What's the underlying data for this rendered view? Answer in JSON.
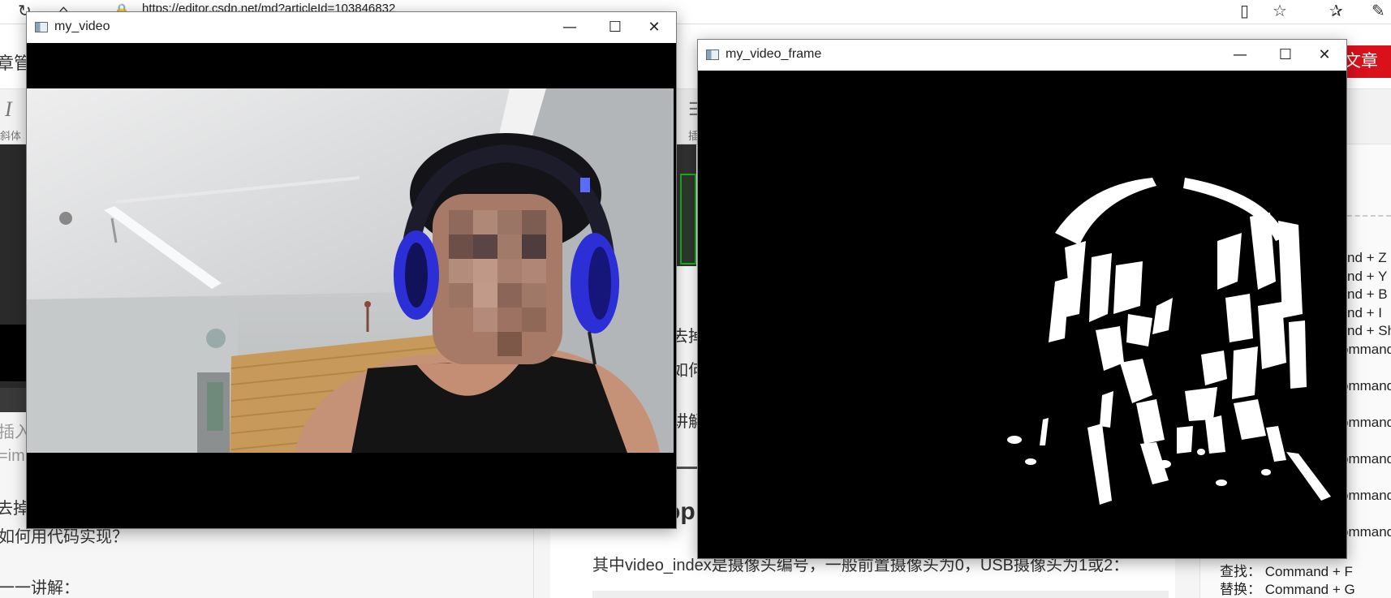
{
  "browser": {
    "url": "https://editor.csdn.net/md?articleId=103846832",
    "refresh_icon": "refresh-icon",
    "home_icon": "home-icon",
    "lock_icon": "lock-icon",
    "reading_icon": "reading-view-icon",
    "favorite_icon": "star-icon",
    "favorites_icon": "favorites-icon",
    "pen_icon": "pen-icon"
  },
  "editor": {
    "left_title": "章管理",
    "publish_label": "文章",
    "toolbar_italic_label": "斜体",
    "toolbar_insert_label": "插",
    "left_lines": [
      "插入",
      "=im",
      "去掉",
      "如何用代码实现？",
      "一一讲解："
    ],
    "mid_lines": [
      "去掉",
      "如何",
      "讲解"
    ],
    "heading_fragment": "op",
    "article_line": "其中video_index是摄像头编号，一般前置摄像头为0，USB摄像头为1或2：",
    "shortcuts": [
      "nd + Z",
      "nd + Y",
      "nd + B",
      "nd + I",
      "nd + Sh",
      "ommand",
      "ommand",
      "ommand",
      "ommand",
      "ommand",
      "ommand"
    ],
    "find_shortcut": "查找：  Command + F",
    "replace_shortcut": "替换：  Command + G"
  },
  "window_video": {
    "title": "my_video",
    "minimize": "—",
    "maximize": "☐",
    "close": "✕"
  },
  "window_frame": {
    "title": "my_video_frame",
    "minimize": "—",
    "maximize": "☐",
    "close": "✕"
  },
  "colors": {
    "publish_red": "#d9111b",
    "headphone_blue": "#2c2fd6"
  }
}
